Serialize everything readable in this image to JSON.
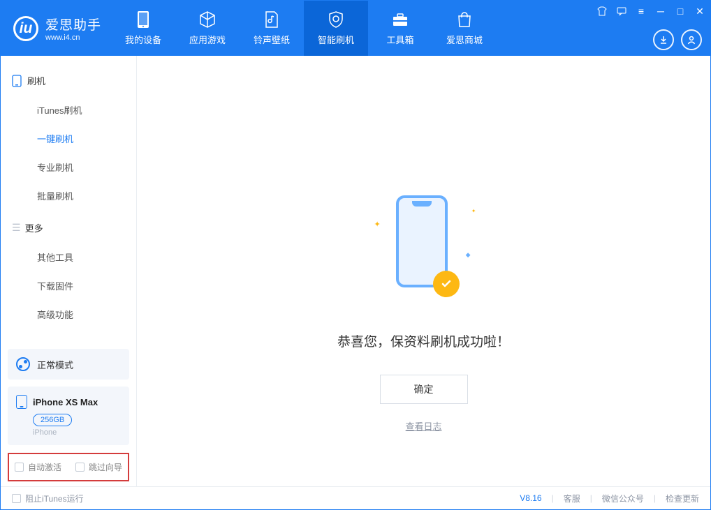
{
  "app": {
    "title": "爱思助手",
    "subtitle": "www.i4.cn"
  },
  "nav": {
    "items": [
      {
        "label": "我的设备"
      },
      {
        "label": "应用游戏"
      },
      {
        "label": "铃声壁纸"
      },
      {
        "label": "智能刷机"
      },
      {
        "label": "工具箱"
      },
      {
        "label": "爱思商城"
      }
    ]
  },
  "sidebar": {
    "group1": {
      "label": "刷机",
      "items": [
        {
          "label": "iTunes刷机"
        },
        {
          "label": "一键刷机"
        },
        {
          "label": "专业刷机"
        },
        {
          "label": "批量刷机"
        }
      ]
    },
    "group2": {
      "label": "更多",
      "items": [
        {
          "label": "其他工具"
        },
        {
          "label": "下载固件"
        },
        {
          "label": "高级功能"
        }
      ]
    },
    "mode": {
      "label": "正常模式"
    },
    "device": {
      "name": "iPhone XS Max",
      "storage": "256GB",
      "type": "iPhone"
    },
    "checks": {
      "auto_activate": "自动激活",
      "skip_guide": "跳过向导"
    }
  },
  "main": {
    "success_text": "恭喜您，保资料刷机成功啦！",
    "confirm": "确定",
    "view_log": "查看日志"
  },
  "footer": {
    "block_itunes": "阻止iTunes运行",
    "version": "V8.16",
    "support": "客服",
    "wechat": "微信公众号",
    "update": "检查更新"
  }
}
